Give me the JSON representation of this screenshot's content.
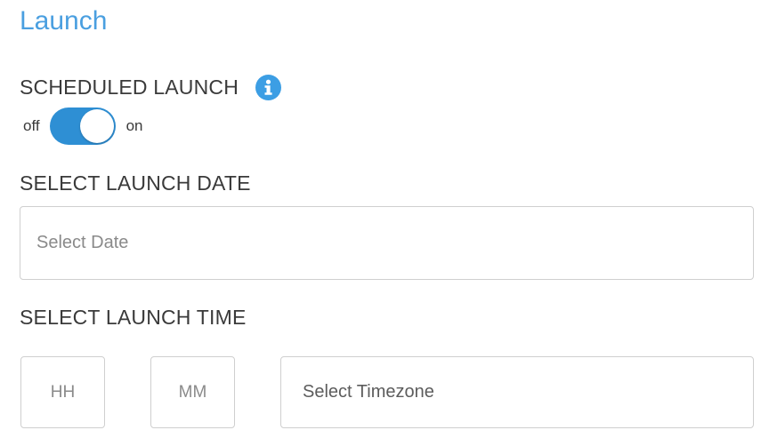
{
  "section": {
    "title": "Launch"
  },
  "scheduled_launch": {
    "label": "SCHEDULED LAUNCH",
    "info_icon": "info-icon",
    "toggle": {
      "off_label": "off",
      "on_label": "on",
      "state": "on",
      "color": "#2e8fd4"
    }
  },
  "launch_date": {
    "label": "SELECT LAUNCH DATE",
    "placeholder": "Select Date"
  },
  "launch_time": {
    "label": "SELECT LAUNCH TIME",
    "hour_placeholder": "HH",
    "minute_placeholder": "MM",
    "timezone_placeholder": "Select Timezone"
  },
  "colors": {
    "title": "#4a9fe0",
    "accent": "#3c9ee4"
  }
}
